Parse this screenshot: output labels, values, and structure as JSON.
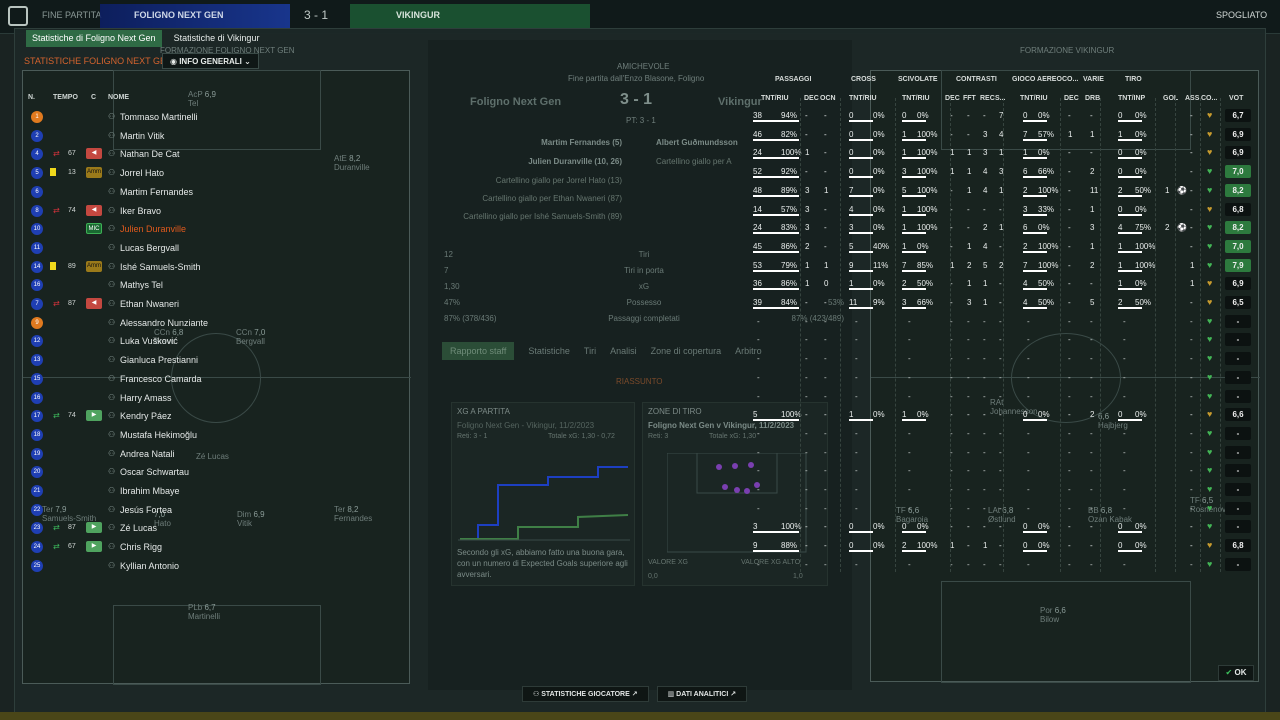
{
  "topbar": {
    "screen_label": "FINE PARTITA",
    "home_team": "FOLIGNO NEXT GEN",
    "score": "3 - 1",
    "away_team": "VIKINGUR",
    "right_label": "SPOGLIATO"
  },
  "tabs": [
    {
      "label": "Statistiche di Foligno Next Gen",
      "active": true
    },
    {
      "label": "Statistiche di Vikingur",
      "active": false
    }
  ],
  "section_title": "STATISTICHE FOLIGNO NEXT GEN",
  "dropdown_label": "INFO GENERALI",
  "left_pitch_title": "FORMAZIONE FOLIGNO NEXT GEN",
  "right_pitch_title": "FORMAZIONE VIKINGUR",
  "roster": {
    "headers": {
      "num": "N.",
      "time": "TEMPO",
      "c": "C",
      "name": "NOME"
    },
    "rows": [
      {
        "num": "1",
        "num_color": "orange",
        "name": "Tommaso Martinelli"
      },
      {
        "num": "2",
        "name": "Martin Vitik"
      },
      {
        "num": "4",
        "name": "Nathan De Cat",
        "minute": "67",
        "sub": "off",
        "badge": "red"
      },
      {
        "num": "5",
        "name": "Jorrel Hato",
        "minute": "13",
        "card": "yellow",
        "badge": "amm",
        "badge_text": "Amm"
      },
      {
        "num": "6",
        "name": "Martim Fernandes"
      },
      {
        "num": "8",
        "name": "Iker Bravo",
        "minute": "74",
        "sub": "off",
        "badge": "red"
      },
      {
        "num": "10",
        "name": "Julien Duranville",
        "highlight": true,
        "badge": "mic",
        "badge_text": "MIC"
      },
      {
        "num": "11",
        "name": "Lucas Bergvall"
      },
      {
        "num": "14",
        "name": "Ishé Samuels-Smith",
        "minute": "89",
        "card": "yellow",
        "badge": "amm",
        "badge_text": "Amm"
      },
      {
        "num": "16",
        "name": "Mathys Tel"
      },
      {
        "num": "7",
        "name": "Ethan Nwaneri",
        "minute": "87",
        "sub": "off",
        "badge": "red"
      },
      {
        "num": "9",
        "num_color": "orange",
        "name": "Alessandro Nunziante"
      },
      {
        "num": "12",
        "name": "Luka Vušković"
      },
      {
        "num": "13",
        "name": "Gianluca Prestianni"
      },
      {
        "num": "15",
        "name": "Francesco Camarda"
      },
      {
        "num": "16",
        "name": "Harry Amass"
      },
      {
        "num": "17",
        "name": "Kendry Páez",
        "minute": "74",
        "sub": "on",
        "badge": "green"
      },
      {
        "num": "18",
        "name": "Mustafa Hekimoğlu"
      },
      {
        "num": "19",
        "name": "Andrea Natali"
      },
      {
        "num": "20",
        "name": "Oscar Schwartau"
      },
      {
        "num": "21",
        "name": "Ibrahim Mbaye"
      },
      {
        "num": "22",
        "name": "Jesús Fortea"
      },
      {
        "num": "23",
        "name": "Zé Lucas",
        "minute": "87",
        "sub": "on",
        "badge": "green"
      },
      {
        "num": "24",
        "name": "Chris Rigg",
        "minute": "67",
        "sub": "on",
        "badge": "green"
      },
      {
        "num": "25",
        "name": "Kyllian Antonio"
      }
    ]
  },
  "pitch_ghosts": [
    {
      "pos": "AcP",
      "rating": "6,9",
      "name": "Tel"
    },
    {
      "pos": "AtE",
      "rating": "8,2",
      "name": "Duranville"
    },
    {
      "pos": "CCn",
      "rating": "6,8",
      "name": "Bravo"
    },
    {
      "pos": "CCn",
      "rating": "7,0",
      "name": "Bergvall"
    },
    {
      "pos": "",
      "rating": "",
      "name": "Zé Lucas"
    },
    {
      "pos": "Ter",
      "rating": "7,9",
      "name": "Samuels-Smith"
    },
    {
      "pos": "",
      "rating": "7,0",
      "name": "Hato"
    },
    {
      "pos": "Dim",
      "rating": "6,9",
      "name": "Vitik"
    },
    {
      "pos": "Ter",
      "rating": "8,2",
      "name": "Fernandes"
    },
    {
      "pos": "PLb",
      "rating": "6,7",
      "name": "Martinelli"
    }
  ],
  "center": {
    "competition": "AMICHEVOLE",
    "venue": "Fine partita dall'Enzo Blasone, Foligno",
    "home": "Foligno Next Gen",
    "away": "Vikingur",
    "score": "3 - 1",
    "pt": "PT: 3 - 1",
    "events": [
      "Martim Fernandes (5)",
      "Julien Duranville (10, 26)",
      "Cartellino giallo per Jorrel Hato (13)",
      "Cartellino giallo per Ethan Nwaneri (87)",
      "Cartellino giallo per Ishé Samuels-Smith (89)"
    ],
    "away_events": [
      "Albert Guðmundsson",
      "Cartellino giallo per A"
    ],
    "stats": [
      {
        "home": "12",
        "label": "Tiri",
        "away": ""
      },
      {
        "home": "7",
        "label": "Tiri in porta",
        "away": ""
      },
      {
        "home": "1,30",
        "label": "xG",
        "away": ""
      },
      {
        "home": "47%",
        "label": "Possesso",
        "away": "53%"
      },
      {
        "home": "87% (378/436)",
        "label": "Passaggi completati",
        "away": "87% (423/489)"
      }
    ],
    "tabs": [
      "Rapporto staff",
      "Statistiche",
      "Tiri",
      "Analisi",
      "Zone di copertura",
      "Arbitro"
    ],
    "summary": "RIASSUNTO",
    "xg_card": {
      "title": "XG A PARTITA",
      "sub": "Foligno Next Gen - Vikingur, 11/2/2023",
      "goals": "Reti: 3 - 1",
      "total": "Totale xG: 1,30 - 0,72",
      "note": "Secondo gli xG, abbiamo fatto una buona gara, con un numero di Expected Goals superiore agli avversari."
    },
    "shot_card": {
      "title": "ZONE DI TIRO",
      "sub": "Foligno Next Gen v Vikingur, 11/2/2023",
      "goals": "Reti: 3",
      "total": "Totale xG: 1,30",
      "legend_low": "VALORE XG",
      "legend_high": "VALORE XG ALTO",
      "scale_min": "0,0",
      "scale_max": "1,0"
    }
  },
  "stats_table": {
    "groups": [
      "PASSAGGI",
      "CROSS",
      "SCIVOLATE",
      "CONTRASTI",
      "GIOCO AEREO",
      "CO...",
      "VARIE",
      "TIRO"
    ],
    "columns": [
      "TNT/RIU",
      "DEC",
      "OCN",
      "TNT/RIU",
      "TNT/RIU",
      "DEC",
      "FFT",
      "REC",
      "S...",
      "TNT/RIU",
      "DEC",
      "DRB",
      "TNT/INP",
      "GOL",
      "ASS",
      "CO...",
      "VOT"
    ],
    "rows": [
      {
        "pass": "38",
        "pass_pct": "94%",
        "dec": "-",
        "ocn": "-",
        "cross": "0",
        "cross_pct": "0%",
        "tack": "0",
        "tack_pct": "0%",
        "cdec": "-",
        "fft": "-",
        "rec": "-",
        "s": "7",
        "air": "0",
        "air_pct": "0%",
        "adec": "-",
        "drb": "-",
        "shot": "0",
        "shot_pct": "0%",
        "gol": "",
        "ass": "-",
        "vot": "6,7"
      },
      {
        "pass": "46",
        "pass_pct": "82%",
        "dec": "-",
        "ocn": "-",
        "cross": "0",
        "cross_pct": "0%",
        "tack": "1",
        "tack_pct": "100%",
        "cdec": "-",
        "fft": "-",
        "rec": "3",
        "s": "4",
        "air": "7",
        "air_pct": "57%",
        "adec": "1",
        "drb": "1",
        "shot": "1",
        "shot_pct": "0%",
        "gol": "",
        "ass": "-",
        "vot": "6,9"
      },
      {
        "pass": "24",
        "pass_pct": "100%",
        "dec": "1",
        "ocn": "-",
        "cross": "0",
        "cross_pct": "0%",
        "tack": "1",
        "tack_pct": "100%",
        "cdec": "1",
        "fft": "1",
        "rec": "3",
        "s": "1",
        "air": "1",
        "air_pct": "0%",
        "adec": "-",
        "drb": "-",
        "shot": "0",
        "shot_pct": "0%",
        "gol": "",
        "ass": "-",
        "vot": "6,9"
      },
      {
        "pass": "52",
        "pass_pct": "92%",
        "dec": "-",
        "ocn": "-",
        "cross": "0",
        "cross_pct": "0%",
        "tack": "3",
        "tack_pct": "100%",
        "cdec": "1",
        "fft": "1",
        "rec": "4",
        "s": "3",
        "air": "6",
        "air_pct": "66%",
        "adec": "-",
        "drb": "2",
        "shot": "0",
        "shot_pct": "0%",
        "gol": "",
        "ass": "-",
        "vot": "7,0"
      },
      {
        "pass": "48",
        "pass_pct": "89%",
        "dec": "3",
        "ocn": "1",
        "cross": "7",
        "cross_pct": "0%",
        "tack": "5",
        "tack_pct": "100%",
        "cdec": "-",
        "fft": "1",
        "rec": "4",
        "s": "1",
        "air": "2",
        "air_pct": "100%",
        "adec": "-",
        "drb": "11",
        "shot": "2",
        "shot_pct": "50%",
        "gol": "1",
        "ass": "-",
        "vot": "8,2"
      },
      {
        "pass": "14",
        "pass_pct": "57%",
        "dec": "3",
        "ocn": "-",
        "cross": "4",
        "cross_pct": "0%",
        "tack": "1",
        "tack_pct": "100%",
        "cdec": "-",
        "fft": "-",
        "rec": "-",
        "s": "-",
        "air": "3",
        "air_pct": "33%",
        "adec": "-",
        "drb": "1",
        "shot": "0",
        "shot_pct": "0%",
        "gol": "",
        "ass": "-",
        "vot": "6,8"
      },
      {
        "pass": "24",
        "pass_pct": "83%",
        "dec": "3",
        "ocn": "-",
        "cross": "3",
        "cross_pct": "0%",
        "tack": "1",
        "tack_pct": "100%",
        "cdec": "-",
        "fft": "-",
        "rec": "2",
        "s": "1",
        "air": "6",
        "air_pct": "0%",
        "adec": "-",
        "drb": "3",
        "shot": "4",
        "shot_pct": "75%",
        "gol": "2",
        "ass": "-",
        "vot": "8,2"
      },
      {
        "pass": "45",
        "pass_pct": "86%",
        "dec": "2",
        "ocn": "-",
        "cross": "5",
        "cross_pct": "40%",
        "tack": "1",
        "tack_pct": "0%",
        "cdec": "-",
        "fft": "1",
        "rec": "4",
        "s": "-",
        "air": "2",
        "air_pct": "100%",
        "adec": "-",
        "drb": "1",
        "shot": "1",
        "shot_pct": "100%",
        "gol": "",
        "ass": "-",
        "vot": "7,0"
      },
      {
        "pass": "53",
        "pass_pct": "79%",
        "dec": "1",
        "ocn": "1",
        "cross": "9",
        "cross_pct": "11%",
        "tack": "7",
        "tack_pct": "85%",
        "cdec": "1",
        "fft": "2",
        "rec": "5",
        "s": "2",
        "air": "7",
        "air_pct": "100%",
        "adec": "-",
        "drb": "2",
        "shot": "1",
        "shot_pct": "100%",
        "gol": "",
        "ass": "1",
        "vot": "7,9"
      },
      {
        "pass": "36",
        "pass_pct": "86%",
        "dec": "1",
        "ocn": "0",
        "cross": "1",
        "cross_pct": "0%",
        "tack": "2",
        "tack_pct": "50%",
        "cdec": "-",
        "fft": "1",
        "rec": "1",
        "s": "-",
        "air": "4",
        "air_pct": "50%",
        "adec": "-",
        "drb": "-",
        "shot": "1",
        "shot_pct": "0%",
        "gol": "",
        "ass": "1",
        "vot": "6,9"
      },
      {
        "pass": "39",
        "pass_pct": "84%",
        "dec": "-",
        "ocn": "-",
        "cross": "11",
        "cross_pct": "9%",
        "tack": "3",
        "tack_pct": "66%",
        "cdec": "-",
        "fft": "3",
        "rec": "1",
        "s": "-",
        "air": "4",
        "air_pct": "50%",
        "adec": "-",
        "drb": "5",
        "shot": "2",
        "shot_pct": "50%",
        "gol": "",
        "ass": "-",
        "vot": "6,5"
      },
      {
        "dash": true,
        "vot": "-"
      },
      {
        "dash": true,
        "vot": "-"
      },
      {
        "dash": true,
        "vot": "-"
      },
      {
        "dash": true,
        "vot": "-"
      },
      {
        "dash": true,
        "vot": "-"
      },
      {
        "pass": "5",
        "pass_pct": "100%",
        "dec": "-",
        "ocn": "-",
        "cross": "1",
        "cross_pct": "0%",
        "tack": "1",
        "tack_pct": "0%",
        "cdec": "-",
        "fft": "-",
        "rec": "-",
        "s": "-",
        "air": "0",
        "air_pct": "0%",
        "adec": "-",
        "drb": "2",
        "shot": "0",
        "shot_pct": "0%",
        "gol": "",
        "ass": "-",
        "vot": "6,6"
      },
      {
        "dash": true,
        "vot": "-"
      },
      {
        "dash": true,
        "vot": "-"
      },
      {
        "dash": true,
        "vot": "-"
      },
      {
        "dash": true,
        "vot": "-"
      },
      {
        "dash": true,
        "vot": "-"
      },
      {
        "pass": "3",
        "pass_pct": "100%",
        "dec": "-",
        "ocn": "-",
        "cross": "0",
        "cross_pct": "0%",
        "tack": "0",
        "tack_pct": "0%",
        "cdec": "-",
        "fft": "-",
        "rec": "-",
        "s": "-",
        "air": "0",
        "air_pct": "0%",
        "adec": "-",
        "drb": "-",
        "shot": "0",
        "shot_pct": "0%",
        "gol": "",
        "ass": "-",
        "vot": "-"
      },
      {
        "pass": "9",
        "pass_pct": "88%",
        "dec": "-",
        "ocn": "-",
        "cross": "0",
        "cross_pct": "0%",
        "tack": "2",
        "tack_pct": "100%",
        "cdec": "1",
        "fft": "-",
        "rec": "1",
        "s": "-",
        "air": "0",
        "air_pct": "0%",
        "adec": "-",
        "drb": "-",
        "shot": "0",
        "shot_pct": "0%",
        "gol": "",
        "ass": "-",
        "vot": "6,8"
      },
      {
        "dash": true,
        "vot": "-"
      }
    ]
  },
  "right_ghosts": [
    {
      "pos": "AcP",
      "rating": "",
      "name": "Hajbjerg"
    },
    {
      "pos": "RAt",
      "rating": "",
      "name": "Johannesson"
    },
    {
      "pos": "",
      "rating": "6,6",
      "name": "Hajbjerg"
    },
    {
      "pos": "TF",
      "rating": "6,6",
      "name": "Bagaroia"
    },
    {
      "pos": "LAt",
      "rating": "6,8",
      "name": "Østlund"
    },
    {
      "pos": "BB",
      "rating": "6,8",
      "name": "Ozan Kabak"
    },
    {
      "pos": "TF",
      "rating": "6,5",
      "name": "Rosnenov"
    },
    {
      "pos": "Por",
      "rating": "6,6",
      "name": "Bilow"
    }
  ],
  "bottom": {
    "player_stats": "STATISTICHE GIOCATORE",
    "analytics": "DATI ANALITICI",
    "ok": "OK"
  },
  "colors": {
    "accent_green": "#2f6b45",
    "orange": "#d4632e",
    "blue_num": "#1f3fb3",
    "vot_good": "#2d7a3e"
  }
}
